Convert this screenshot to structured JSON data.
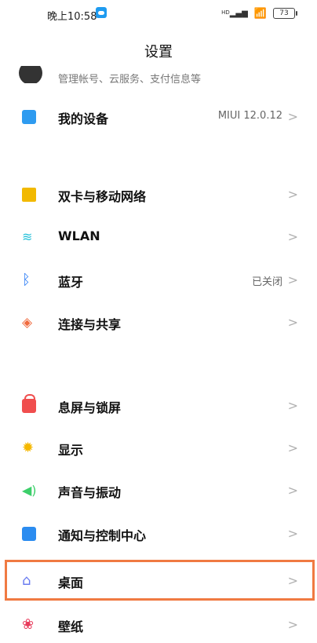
{
  "status_bar": {
    "time": "晚上10:58",
    "battery": "73",
    "hd_label": "HD"
  },
  "header": {
    "title": "设置"
  },
  "account": {
    "subtitle": "管理帐号、云服务、支付信息等"
  },
  "groups": [
    {
      "items": [
        {
          "label": "我的设备",
          "value": "MIUI 12.0.12",
          "icon": "device-icon"
        }
      ]
    },
    {
      "items": [
        {
          "label": "双卡与移动网络",
          "value": "",
          "icon": "sim-card-icon"
        },
        {
          "label": "WLAN",
          "value": "",
          "icon": "wifi-icon"
        },
        {
          "label": "蓝牙",
          "value": "已关闭",
          "icon": "bluetooth-icon"
        },
        {
          "label": "连接与共享",
          "value": "",
          "icon": "share-icon"
        }
      ]
    },
    {
      "items": [
        {
          "label": "息屏与锁屏",
          "value": "",
          "icon": "lock-icon"
        },
        {
          "label": "显示",
          "value": "",
          "icon": "sun-icon"
        },
        {
          "label": "声音与振动",
          "value": "",
          "icon": "speaker-icon"
        },
        {
          "label": "通知与控制中心",
          "value": "",
          "icon": "notification-icon"
        },
        {
          "label": "桌面",
          "value": "",
          "icon": "home-icon"
        },
        {
          "label": "壁纸",
          "value": "",
          "icon": "wallpaper-icon"
        }
      ]
    }
  ],
  "colors": {
    "highlight": "#f07a42",
    "device": "#2e9bf0",
    "sim": "#f2b900",
    "wifi": "#23c0d9",
    "bluetooth": "#2b7cf6",
    "share": "#f06b3f",
    "lock": "#f04e4e",
    "display": "#f5b800",
    "sound": "#3ccf6a",
    "notify": "#2b8cf0",
    "home": "#6a7cf0",
    "wallpaper": "#e83c5c"
  }
}
